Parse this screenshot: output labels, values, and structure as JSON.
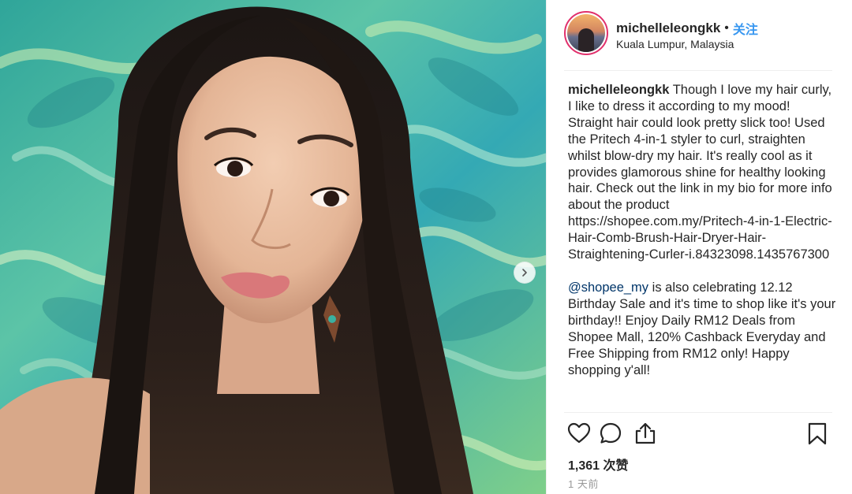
{
  "post": {
    "username": "michelleleongkk",
    "separator": "•",
    "follow_label": "关注",
    "location": "Kuala Lumpur, Malaysia",
    "caption_user": "michelleleongkk",
    "caption_text": "Though I love my hair curly, I like to dress it according to my mood! Straight hair could look pretty slick too! Used the Pritech 4-in-1 styler to curl, straighten whilst blow-dry my hair. It's really cool as it provides glamorous shine for healthy looking hair. Check out the link in my bio for more info about the product https://shopee.com.my/Pritech-4-in-1-Electric-Hair-Comb-Brush-Hair-Dryer-Hair-Straightening-Curler-i.84323098.1435767300",
    "caption_mention": "@shopee_my",
    "caption_text_2": "is also celebrating 12.12 Birthday Sale and it's time to shop like it's your birthday!! Enjoy Daily RM12 Deals from Shopee Mall, 120% Cashback Everyday and Free Shipping from RM12 only! Happy shopping y'all!",
    "likes": "1,361 次赞",
    "time_ago": "1 天前"
  },
  "icons": {
    "like": "heart-outline-icon",
    "comment": "comment-bubble-icon",
    "share": "share-upload-icon",
    "save": "bookmark-icon",
    "next": "chevron-right-icon"
  },
  "colors": {
    "link_blue": "#3897f0",
    "mention": "#003569",
    "avatar_ring": "#e1306c",
    "text": "#262626",
    "muted": "#999999"
  }
}
